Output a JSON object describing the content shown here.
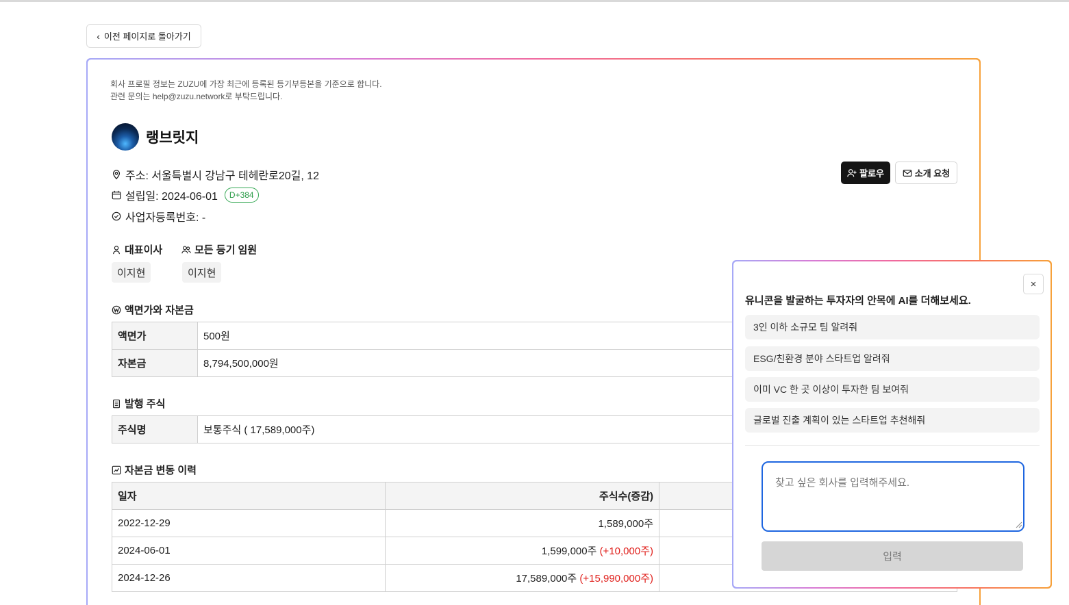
{
  "nav": {
    "back_label": "이전 페이지로 돌아가기"
  },
  "notice": {
    "line1": "회사 프로필 정보는 ZUZU에 가장 최근에 등록된 등기부등본을 기준으로 합니다.",
    "line2": "관련 문의는 help@zuzu.network로 부탁드립니다."
  },
  "company": {
    "name": "랭브릿지",
    "address": "주소: 서울특별시 강남구 테헤란로20길, 12",
    "founded": "설립일: 2024-06-01",
    "d_badge": "D+384",
    "biz_no": "사업자등록번호: -"
  },
  "actions": {
    "follow": "팔로우",
    "intro": "소개 요청"
  },
  "people": {
    "ceo_title": "대표이사",
    "ceo": "이지현",
    "officers_title": "모든 등기 임원",
    "officer": "이지현"
  },
  "capital": {
    "title": "액면가와 자본금",
    "rows": [
      {
        "label": "액면가",
        "value": "500원"
      },
      {
        "label": "자본금",
        "value": "8,794,500,000원"
      }
    ]
  },
  "shares": {
    "title": "발행 주식",
    "rows": [
      {
        "label": "주식명",
        "value": "보통주식 ( 17,589,000주)"
      }
    ]
  },
  "history": {
    "title": "자본금 변동 이력",
    "headers": {
      "date": "일자",
      "count": "주식수(증감)"
    },
    "rows": [
      {
        "date": "2022-12-29",
        "count": "1,589,000주",
        "delta": ""
      },
      {
        "date": "2024-06-01",
        "count": "1,599,000주",
        "delta": "(+10,000주)"
      },
      {
        "date": "2024-12-26",
        "count": "17,589,000주",
        "delta": "(+15,990,000주)"
      }
    ]
  },
  "ai": {
    "heading": "유니콘을 발굴하는 투자자의 안목에 AI를 더해보세요.",
    "suggestions": [
      "3인 이하 소규모 팀 알려줘",
      "ESG/친환경 분야 스타트업 알려줘",
      "이미 VC 한 곳 이상이 투자한 팀 보여줘",
      "글로벌 진출 계획이 있는 스타트업 추천해줘"
    ],
    "input_placeholder": "찾고 싶은 회사를 입력해주세요.",
    "submit": "입력",
    "close": "×"
  }
}
